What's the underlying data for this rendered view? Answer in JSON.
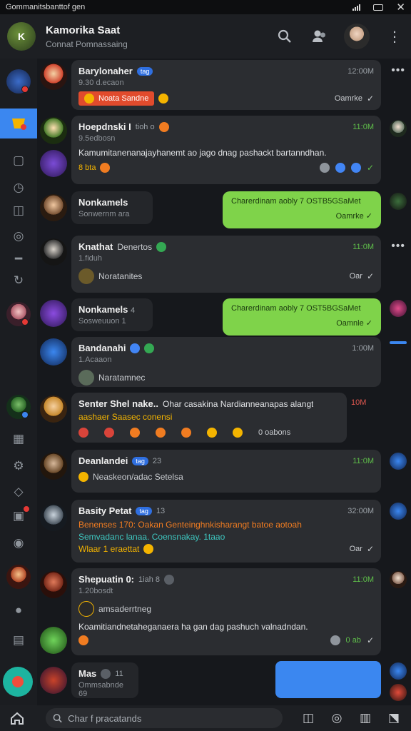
{
  "status_bar": {
    "title": "Gommanitsbanttof gen"
  },
  "header": {
    "title": "Kamorika Saat",
    "subtitle": "Connat Pomnassaing",
    "avatar_initials": "K"
  },
  "colors": {
    "accent": "#3b87f0",
    "green_bubble": "#7fd34a",
    "badge_red": "#e53935",
    "card_bg": "#2b2d31"
  },
  "messages": [
    {
      "name": "Barylonaher",
      "pill": "tag",
      "sub": "9.30 d.ecaon",
      "time": "12:00M",
      "chip_text": "Noata Sandne",
      "status": "Oamrke",
      "icon": "check-icon"
    },
    {
      "name": "Hoepdnski I",
      "extra": "tioh o",
      "sub": "9.5edbosn",
      "time": "11:0M",
      "body": "Kamumitanenanajayhanemt ao jago dnag pashackt bartanndhan.",
      "reactions": "8 bta",
      "time_color": "green"
    },
    {
      "name": "Nonkamels",
      "sub": "Sonwernm ara",
      "bubble": "Charerdinam aobly 7 OSTB5GSaMet",
      "bubble_status": "Oamrke"
    },
    {
      "name": "Knathat",
      "extra": "Denertos",
      "sub": "1.fiduh",
      "time": "11:0M",
      "mini": "Noratanites",
      "status": "Oar",
      "time_color": "green"
    },
    {
      "name": "Nonkamels",
      "extra": "4",
      "sub": "Sosweuuon 1",
      "bubble": "Charerdinam aobly 7 OST5BGSaMet",
      "bubble_status": "Oamnle"
    },
    {
      "name": "Bandanahi",
      "sub": "1.Acaaon",
      "time": "1:00M",
      "mini": "Naratamnec"
    },
    {
      "name": "Senter Shel nake..",
      "body": "Ohar casakina Nardianneanapas alangt",
      "line2": "aashaer Saasec conensi",
      "time": "10M",
      "count": "0 oabons",
      "time_color": "red"
    },
    {
      "name": "Deanlandei",
      "pill": "tag",
      "extra": "23",
      "time": "11:0M",
      "mini": "Neaskeon/adac Setelsa",
      "time_color": "green"
    },
    {
      "name": "Basity Petat",
      "pill": "tag",
      "extra": "13",
      "time": "32:00M",
      "body": "Benenses 170: Oakan Genteinghnkisharangt batoe aotoah",
      "line2": "Semvadanc lanaa. Coensnakay. 1taao",
      "line3": "Wlaar 1 eraettat",
      "status": "Oar"
    },
    {
      "name": "Shepuatin 0:",
      "extra": "1iah 8",
      "sub": "1.20bosdt",
      "time": "11:0M",
      "mini": "amsaderrtneg",
      "body": "Koamitiandnetaheganaera ha gan dag pashuch valnadndan.",
      "status": "0 ab",
      "time_color": "green"
    },
    {
      "name": "Mas",
      "extra": "11",
      "sub": "Ommsabnde 69"
    }
  ],
  "search": {
    "placeholder": "Char f pracatands"
  },
  "labels": {
    "more": "•••"
  }
}
